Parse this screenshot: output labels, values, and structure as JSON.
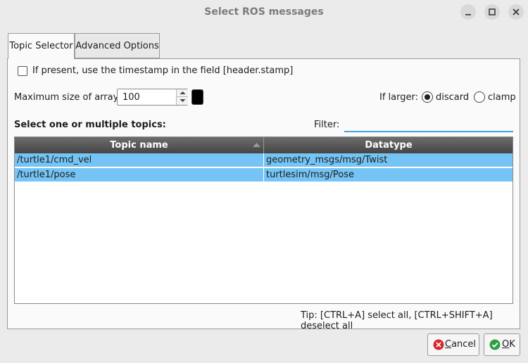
{
  "window": {
    "title": "Select ROS messages"
  },
  "tabs": [
    {
      "label": "Topic Selector",
      "active": true
    },
    {
      "label": "Advanced Options",
      "active": false
    }
  ],
  "options": {
    "timestamp_checkbox_label": "If present, use the timestamp in the field [header.stamp]",
    "timestamp_checked": false,
    "max_array_label": "Maximum size of arrays:",
    "max_array_value": "100",
    "swatch_color": "#000000",
    "if_larger_label": "If larger:",
    "discard_label": "discard",
    "clamp_label": "clamp",
    "selected_mode": "discard"
  },
  "topics": {
    "section_label": "Select one or multiple topics:",
    "filter_label": "Filter:",
    "filter_value": "",
    "columns": [
      "Topic name",
      "Datatype"
    ],
    "rows": [
      {
        "topic": "/turtle1/cmd_vel",
        "type": "geometry_msgs/msg/Twist"
      },
      {
        "topic": "/turtle1/pose",
        "type": "turtlesim/msg/Pose"
      }
    ],
    "selection_color": "#75c4f5"
  },
  "tip": "Tip: [CTRL+A] select all, [CTRL+SHIFT+A] deselect all",
  "buttons": {
    "cancel_first": "C",
    "cancel_rest": "ancel",
    "ok_first": "O",
    "ok_rest": "K"
  }
}
